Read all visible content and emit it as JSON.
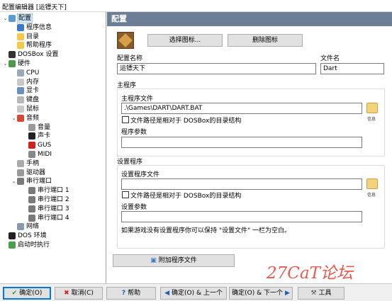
{
  "window": {
    "title": "配置编辑器 [运镖天下]"
  },
  "tree": {
    "nodes": [
      {
        "label": "配置",
        "level": 0,
        "expander": "minus",
        "color": "#5b9bd5",
        "selected": true
      },
      {
        "label": "程序信息",
        "level": 1,
        "color": "#3c78c8"
      },
      {
        "label": "目录",
        "level": 1,
        "color": "#f4c84a"
      },
      {
        "label": "帮助程序",
        "level": 1,
        "color": "#f4c84a"
      },
      {
        "label": "DOSBox 设置",
        "level": 0,
        "color": "#333333"
      },
      {
        "label": "硬件",
        "level": 0,
        "expander": "minus",
        "color": "#4a9a4a"
      },
      {
        "label": "CPU",
        "level": 1,
        "color": "#9aa8b8"
      },
      {
        "label": "内存",
        "level": 1,
        "color": "#c8c8c8"
      },
      {
        "label": "显卡",
        "level": 1,
        "color": "#6a8fc0"
      },
      {
        "label": "键盘",
        "level": 1,
        "color": "#b8b8b8"
      },
      {
        "label": "鼠标",
        "level": 1,
        "color": "#c8c8c8"
      },
      {
        "label": "音频",
        "level": 1,
        "expander": "minus",
        "color": "#d04a3a"
      },
      {
        "label": "音量",
        "level": 2,
        "color": "#9a9a9a"
      },
      {
        "label": "声卡",
        "level": 2,
        "color": "#222222"
      },
      {
        "label": "GUS",
        "level": 2,
        "color": "#cc2222"
      },
      {
        "label": "MIDI",
        "level": 2,
        "color": "#888888"
      },
      {
        "label": "手柄",
        "level": 1,
        "color": "#aaaaaa"
      },
      {
        "label": "驱动器",
        "level": 1,
        "color": "#9a9a9a"
      },
      {
        "label": "串行端口",
        "level": 1,
        "expander": "minus",
        "color": "#7a7a7a"
      },
      {
        "label": "串行端口 1",
        "level": 2,
        "color": "#7a7a7a"
      },
      {
        "label": "串行端口 2",
        "level": 2,
        "color": "#7a7a7a"
      },
      {
        "label": "串行端口 3",
        "level": 2,
        "color": "#7a7a7a"
      },
      {
        "label": "串行端口 4",
        "level": 2,
        "color": "#7a7a7a"
      },
      {
        "label": "网络",
        "level": 1,
        "color": "#8a9aaa"
      },
      {
        "label": "DOS 环境",
        "level": 0,
        "color": "#222222"
      },
      {
        "label": "启动时执行",
        "level": 0,
        "color": "#4aa04a"
      }
    ]
  },
  "panel": {
    "header": "配置",
    "select_icon_button": "选择图标...",
    "delete_icon_button": "删除图标",
    "config_name_label": "配置名称",
    "config_name_value": "运镖天下",
    "filename_label": "文件名",
    "filename_value": "Dart",
    "main_program": {
      "title": "主程序",
      "file_label": "主程序文件",
      "file_value": ".\\Games\\DART\\DART.BAT",
      "relative_checkbox": "文件路径是相对于 DOSBox的目录结构",
      "relative_checked": false,
      "params_label": "程序参数",
      "params_value": "",
      "info_note": "信息"
    },
    "setup_program": {
      "title": "设置程序",
      "file_label": "设置程序文件",
      "file_value": "",
      "relative_checkbox": "文件路径是相对于 DOSBox的目录结构",
      "relative_checked": false,
      "params_label": "设置参数",
      "params_value": "",
      "info_note": "信息",
      "hint": "如果游戏没有设置程序你可以保持 \"设置文件\" 一栏为空白。"
    },
    "additional_files_button": "附加程序文件"
  },
  "bottom": {
    "ok": "确定(O)",
    "cancel": "取消(C)",
    "help": "帮助",
    "ok_prev": "确定(O) & 上一个",
    "ok_next": "确定(O) & 下一个",
    "tools": "工具"
  },
  "watermark": "27CaT论坛",
  "colors": {
    "header_bg": "#6b7e96",
    "selection": "#cce8ff",
    "accent": "#0078d7"
  }
}
